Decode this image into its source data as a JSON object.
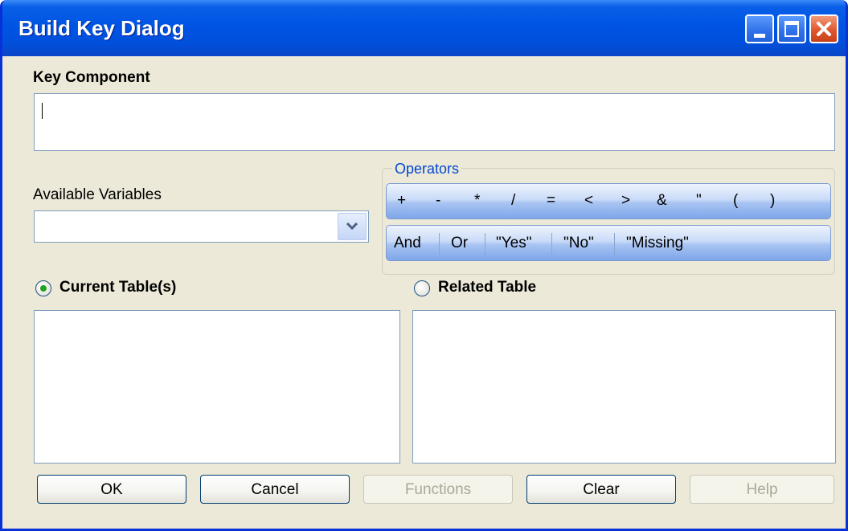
{
  "window": {
    "title": "Build Key Dialog"
  },
  "key_component": {
    "label": "Key Component",
    "value": ""
  },
  "available_variables": {
    "label": "Available Variables",
    "selected": ""
  },
  "operators": {
    "label": "Operators",
    "row1": [
      "+",
      "-",
      "*",
      "/",
      "=",
      "<",
      ">",
      "&",
      "\"",
      "(",
      ")"
    ],
    "row2": [
      "And",
      "Or",
      "\"Yes\"",
      "\"No\"",
      "\"Missing\""
    ]
  },
  "tables": {
    "current": {
      "label": "Current Table(s)",
      "selected": true
    },
    "related": {
      "label": "Related Table",
      "selected": false
    }
  },
  "buttons": {
    "ok": "OK",
    "cancel": "Cancel",
    "functions": "Functions",
    "clear": "Clear",
    "help": "Help"
  },
  "colors": {
    "titlebar": "#0054e3",
    "dialog_bg": "#ece9d8",
    "operators_legend": "#0046d5"
  }
}
